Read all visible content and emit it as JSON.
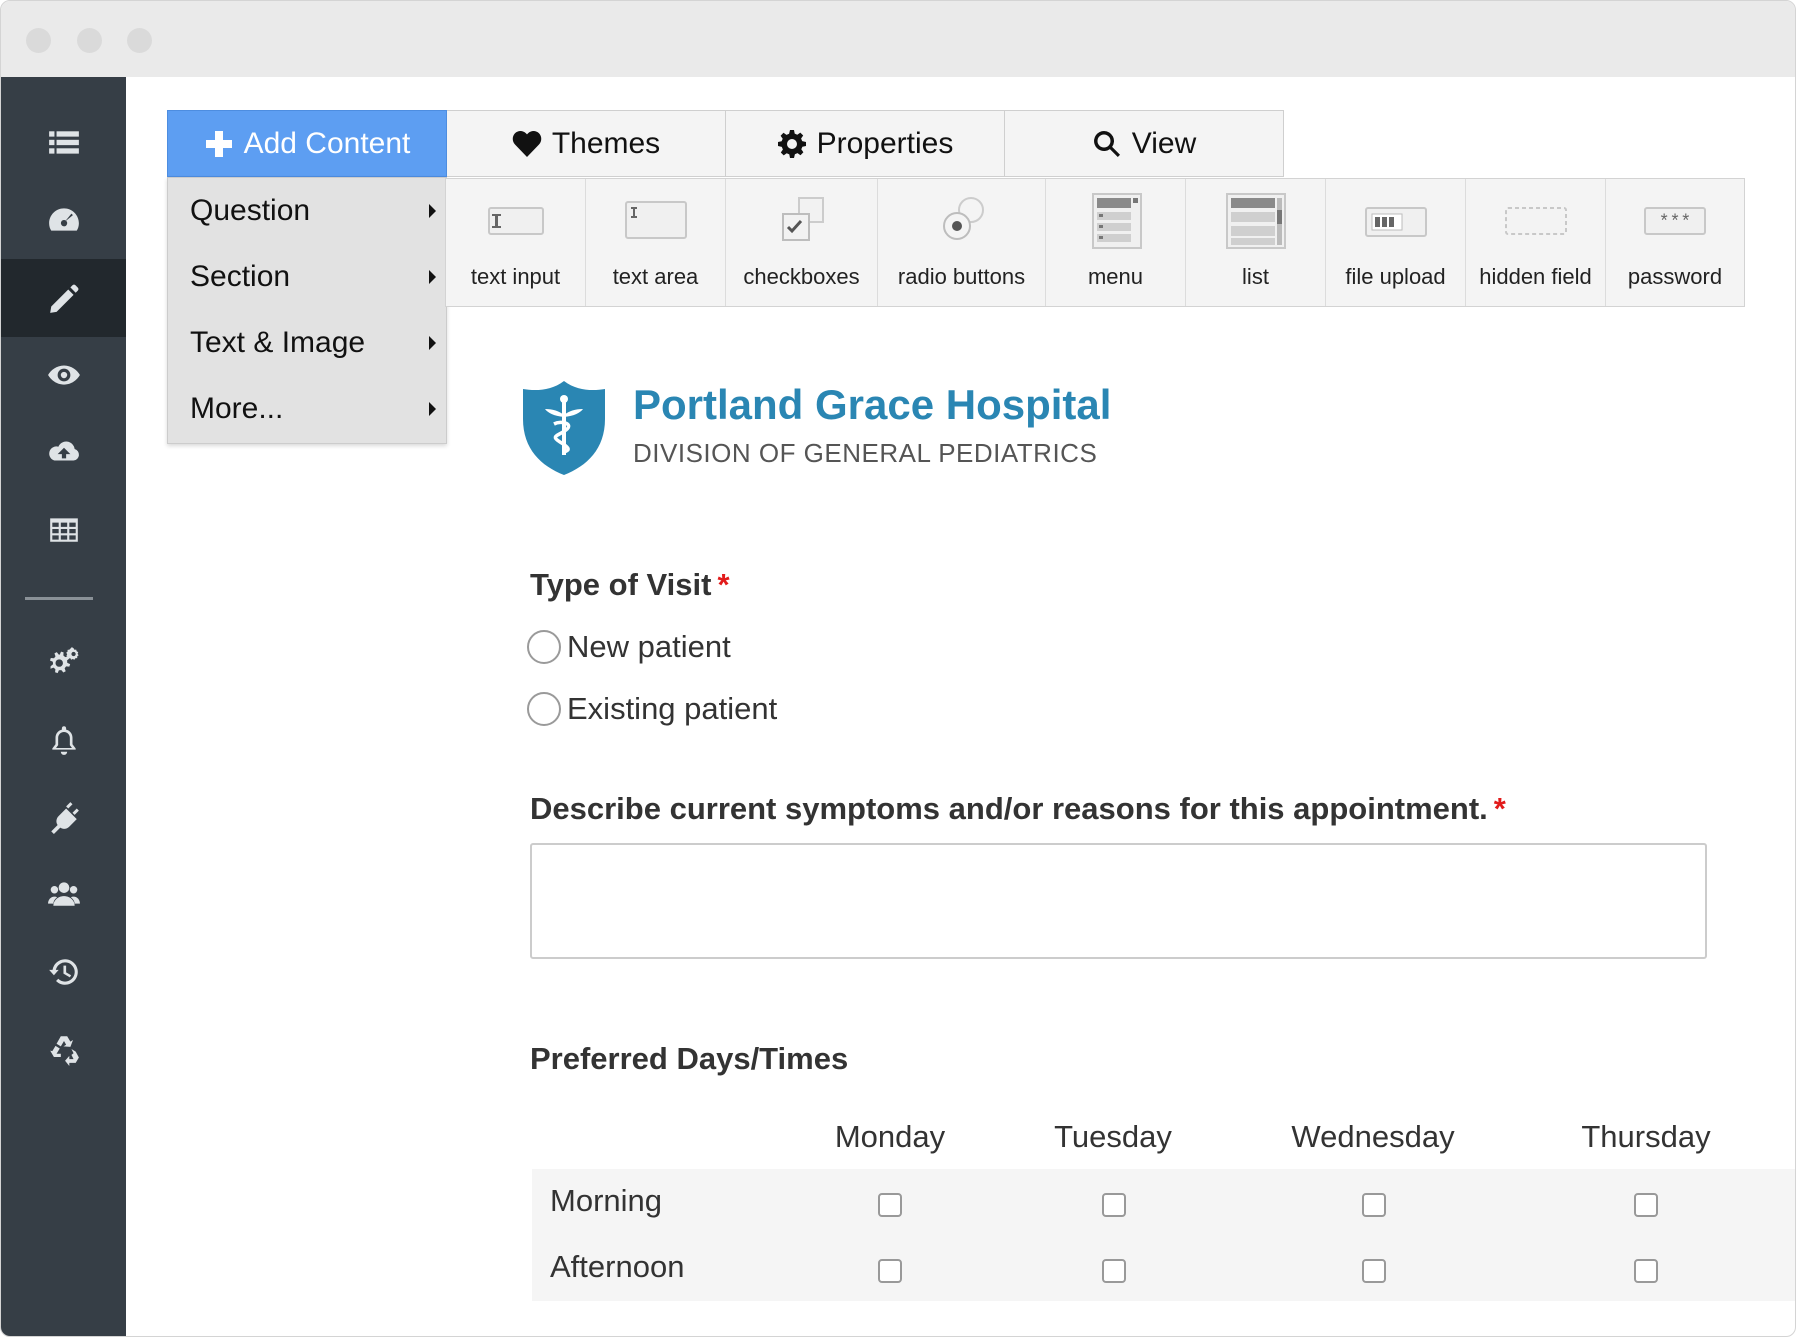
{
  "tabs": [
    {
      "label": "Add Content",
      "icon": "plus-icon",
      "active": true
    },
    {
      "label": "Themes",
      "icon": "heart-icon"
    },
    {
      "label": "Properties",
      "icon": "gear-icon"
    },
    {
      "label": "View",
      "icon": "search-icon"
    }
  ],
  "menu": {
    "items": [
      {
        "label": "Question"
      },
      {
        "label": "Section"
      },
      {
        "label": "Text & Image"
      },
      {
        "label": "More..."
      }
    ]
  },
  "toolbar": {
    "items": [
      {
        "label": "text input",
        "icon": "text-input-icon"
      },
      {
        "label": "text area",
        "icon": "text-area-icon"
      },
      {
        "label": "checkboxes",
        "icon": "checkboxes-icon"
      },
      {
        "label": "radio buttons",
        "icon": "radio-buttons-icon"
      },
      {
        "label": "menu",
        "icon": "menu-icon"
      },
      {
        "label": "list",
        "icon": "list-icon"
      },
      {
        "label": "file upload",
        "icon": "file-upload-icon"
      },
      {
        "label": "hidden field",
        "icon": "hidden-field-icon"
      },
      {
        "label": "password",
        "icon": "password-icon"
      }
    ]
  },
  "sidebar": {
    "icons": [
      "list-icon",
      "dashboard-icon",
      "pencil-icon",
      "eye-icon",
      "cloud-upload-icon",
      "table-icon",
      "gears-icon",
      "bell-icon",
      "plug-icon",
      "users-icon",
      "history-icon",
      "recycle-icon"
    ],
    "active": "pencil-icon"
  },
  "form": {
    "org_name": "Portland Grace Hospital",
    "org_subtitle": "DIVISION OF GENERAL PEDIATRICS",
    "visit_question": "Type of Visit",
    "required_mark": "*",
    "visit_options": [
      "New patient",
      "Existing patient"
    ],
    "symptoms_question": "Describe current symptoms and/or reasons for this appointment.",
    "symptoms_value": "",
    "days_question": "Preferred Days/Times",
    "days": [
      "Monday",
      "Tuesday",
      "Wednesday",
      "Thursday"
    ],
    "times": [
      "Morning",
      "Afternoon"
    ]
  },
  "colors": {
    "accent": "#5d9ef2",
    "brand": "#2a86b3",
    "sidebar": "#363e46",
    "required": "#e21b1b"
  }
}
